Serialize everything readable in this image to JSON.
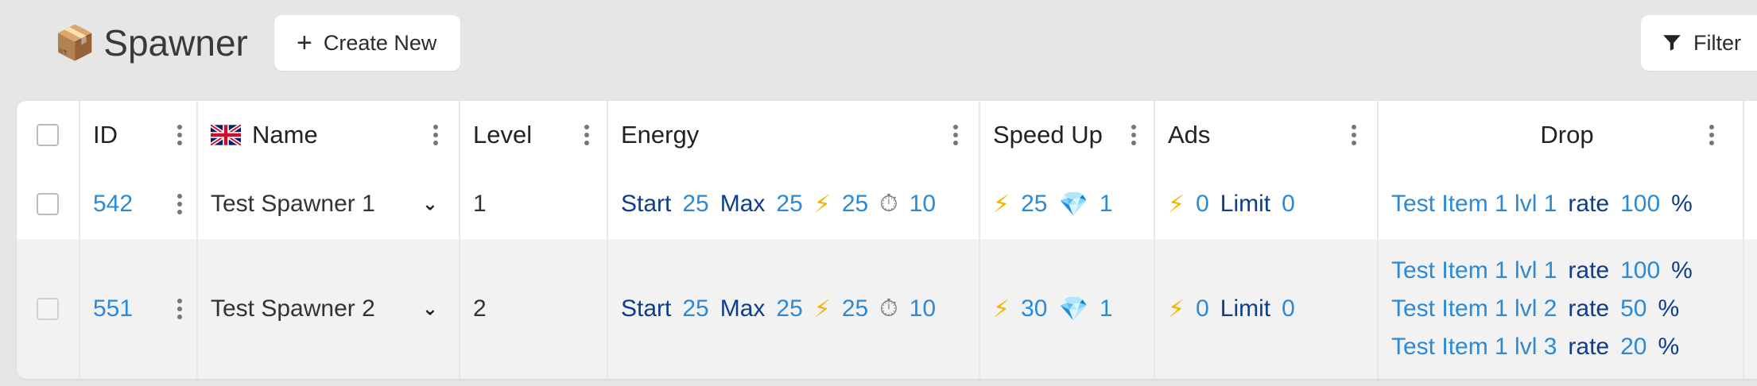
{
  "header": {
    "title_emoji": "📦",
    "title": "Spawner",
    "create_label": "Create New",
    "filter_label": "Filter"
  },
  "table": {
    "columns": {
      "id": "ID",
      "name": "Name",
      "level": "Level",
      "energy": "Energy",
      "speed_up": "Speed Up",
      "ads": "Ads",
      "drop": "Drop"
    },
    "labels": {
      "start": "Start",
      "max": "Max",
      "limit": "Limit",
      "rate": "rate",
      "percent": "%"
    },
    "rows": [
      {
        "id": "542",
        "name": "Test Spawner 1",
        "level": "1",
        "energy": {
          "start": "25",
          "max": "25",
          "bolt": "25",
          "timer": "10"
        },
        "speed_up": {
          "bolt": "25",
          "gem": "1"
        },
        "ads": {
          "bolt": "0",
          "limit": "0"
        },
        "drop": [
          {
            "item": "Test Item 1 lvl 1",
            "rate": "100"
          }
        ]
      },
      {
        "id": "551",
        "name": "Test Spawner 2",
        "level": "2",
        "energy": {
          "start": "25",
          "max": "25",
          "bolt": "25",
          "timer": "10"
        },
        "speed_up": {
          "bolt": "30",
          "gem": "1"
        },
        "ads": {
          "bolt": "0",
          "limit": "0"
        },
        "drop": [
          {
            "item": "Test Item 1 lvl 1",
            "rate": "100"
          },
          {
            "item": "Test Item 1 lvl 2",
            "rate": "50"
          },
          {
            "item": "Test Item 1 lvl 3",
            "rate": "20"
          }
        ]
      }
    ]
  },
  "icons": {
    "bolt": "⚡",
    "gem": "💎",
    "timer": "⏱",
    "chevron": "⌄",
    "plus": "+"
  },
  "colors": {
    "link": "#2a8ad8",
    "label": "#0d3d8c",
    "background": "#e6e6e6",
    "row_alt": "#f2f2f2"
  }
}
